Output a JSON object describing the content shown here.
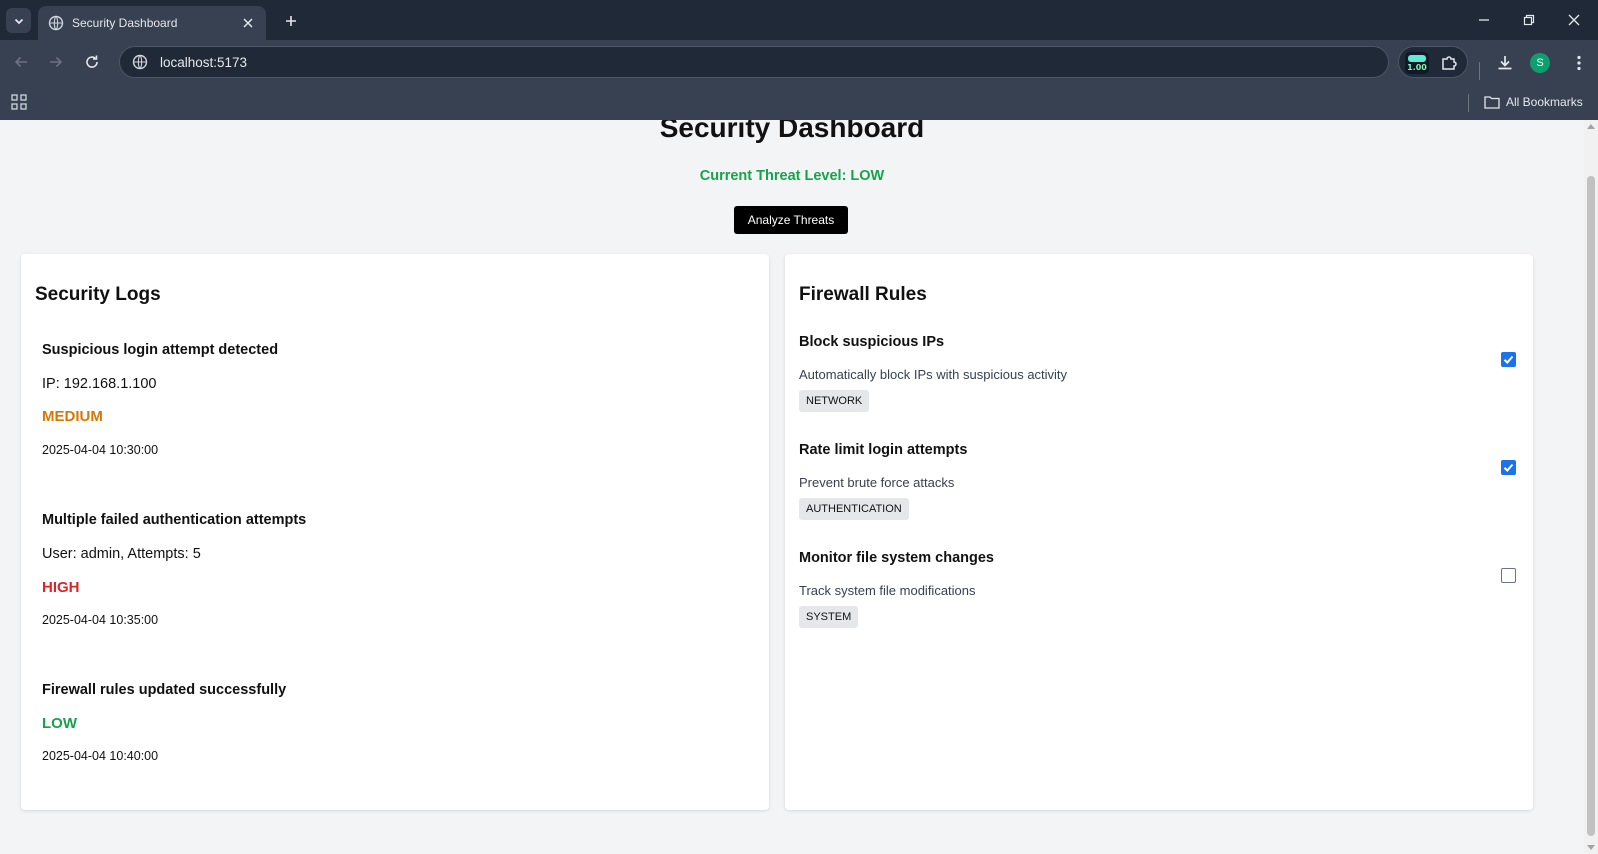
{
  "browser": {
    "tab_title": "Security Dashboard",
    "url": "localhost:5173",
    "extension_badge": "1.00",
    "profile_initial": "S",
    "bookmarks_label": "All Bookmarks"
  },
  "page": {
    "title": "Security Dashboard",
    "threat_level": "Current Threat Level: LOW",
    "analyze_button": "Analyze Threats"
  },
  "security_logs": {
    "heading": "Security Logs",
    "items": [
      {
        "message": "Suspicious login attempt detected",
        "detail": "IP: 192.168.1.100",
        "severity": "MEDIUM",
        "severity_color": "#d97706",
        "timestamp": "2025-04-04 10:30:00"
      },
      {
        "message": "Multiple failed authentication attempts",
        "detail": "User: admin, Attempts: 5",
        "severity": "HIGH",
        "severity_color": "#dc2626",
        "timestamp": "2025-04-04 10:35:00"
      },
      {
        "message": "Firewall rules updated successfully",
        "severity": "LOW",
        "severity_color": "#16a34a",
        "timestamp": "2025-04-04 10:40:00"
      }
    ]
  },
  "firewall_rules": {
    "heading": "Firewall Rules",
    "items": [
      {
        "name": "Block suspicious IPs",
        "description": "Automatically block IPs with suspicious activity",
        "category": "NETWORK",
        "enabled": true
      },
      {
        "name": "Rate limit login attempts",
        "description": "Prevent brute force attacks",
        "category": "AUTHENTICATION",
        "enabled": true
      },
      {
        "name": "Monitor file system changes",
        "description": "Track system file modifications",
        "category": "SYSTEM",
        "enabled": false
      }
    ]
  },
  "colors": {
    "threat_low": "#16a34a",
    "checkbox_on": "#1a73e8"
  }
}
